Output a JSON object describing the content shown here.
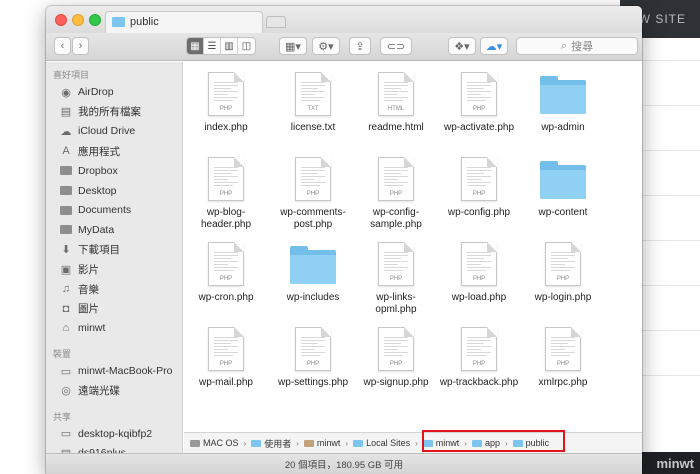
{
  "background_site": {
    "button_fragment": "EW SITE",
    "footer_text": "minwt"
  },
  "window": {
    "tab_title": "public"
  },
  "toolbar": {
    "search_placeholder": "搜尋",
    "view_modes": [
      "icon",
      "list",
      "column",
      "coverflow"
    ],
    "active_view": "icon"
  },
  "sidebar": {
    "sections": [
      {
        "header": "喜好項目",
        "items": [
          {
            "label": "AirDrop",
            "icon": "airdrop-icon"
          },
          {
            "label": "我的所有檔案",
            "icon": "all-files-icon"
          },
          {
            "label": "iCloud Drive",
            "icon": "cloud-icon"
          },
          {
            "label": "應用程式",
            "icon": "applications-icon"
          },
          {
            "label": "Dropbox",
            "icon": "folder-icon"
          },
          {
            "label": "Desktop",
            "icon": "folder-icon"
          },
          {
            "label": "Documents",
            "icon": "folder-icon"
          },
          {
            "label": "MyData",
            "icon": "folder-icon"
          },
          {
            "label": "下載項目",
            "icon": "download-icon"
          },
          {
            "label": "影片",
            "icon": "movie-icon"
          },
          {
            "label": "音樂",
            "icon": "music-icon"
          },
          {
            "label": "圖片",
            "icon": "camera-icon"
          },
          {
            "label": "minwt",
            "icon": "home-icon"
          }
        ]
      },
      {
        "header": "裝置",
        "items": [
          {
            "label": "minwt-MacBook-Pro",
            "icon": "laptop-icon"
          },
          {
            "label": "遠端光碟",
            "icon": "disc-icon"
          }
        ]
      },
      {
        "header": "共享",
        "items": [
          {
            "label": "desktop-kqibfp2",
            "icon": "pc-icon"
          },
          {
            "label": "ds916plus",
            "icon": "server-icon"
          }
        ]
      }
    ]
  },
  "files": [
    {
      "name": "index.php",
      "type": "doc",
      "ext": "PHP"
    },
    {
      "name": "license.txt",
      "type": "doc",
      "ext": "TXT"
    },
    {
      "name": "readme.html",
      "type": "doc",
      "ext": "HTML"
    },
    {
      "name": "wp-activate.php",
      "type": "doc",
      "ext": "PHP"
    },
    {
      "name": "wp-admin",
      "type": "folder",
      "ext": ""
    },
    {
      "name": "wp-blog-header.php",
      "type": "doc",
      "ext": "PHP"
    },
    {
      "name": "wp-comments-post.php",
      "type": "doc",
      "ext": "PHP"
    },
    {
      "name": "wp-config-sample.php",
      "type": "doc",
      "ext": "PHP"
    },
    {
      "name": "wp-config.php",
      "type": "doc",
      "ext": "PHP"
    },
    {
      "name": "wp-content",
      "type": "folder",
      "ext": ""
    },
    {
      "name": "wp-cron.php",
      "type": "doc",
      "ext": "PHP"
    },
    {
      "name": "wp-includes",
      "type": "folder",
      "ext": ""
    },
    {
      "name": "wp-links-opml.php",
      "type": "doc",
      "ext": "PHP"
    },
    {
      "name": "wp-load.php",
      "type": "doc",
      "ext": "PHP"
    },
    {
      "name": "wp-login.php",
      "type": "doc",
      "ext": "PHP"
    },
    {
      "name": "wp-mail.php",
      "type": "doc",
      "ext": "PHP"
    },
    {
      "name": "wp-settings.php",
      "type": "doc",
      "ext": "PHP"
    },
    {
      "name": "wp-signup.php",
      "type": "doc",
      "ext": "PHP"
    },
    {
      "name": "wp-trackback.php",
      "type": "doc",
      "ext": "PHP"
    },
    {
      "name": "xmlrpc.php",
      "type": "doc",
      "ext": "PHP"
    }
  ],
  "pathbar": {
    "items": [
      {
        "label": "MAC OS",
        "icon": "disk-icon"
      },
      {
        "label": "使用者",
        "icon": "folder-icon"
      },
      {
        "label": "minwt",
        "icon": "home-icon"
      },
      {
        "label": "Local Sites",
        "icon": "folder-icon"
      },
      {
        "label": "minwt",
        "icon": "folder-icon"
      },
      {
        "label": "app",
        "icon": "folder-icon"
      },
      {
        "label": "public",
        "icon": "folder-icon"
      }
    ],
    "highlight_color": "#e0141c"
  },
  "status": {
    "text": "20 個項目，180.95 GB 可用"
  },
  "colors": {
    "folder_blue": "#73bfe9",
    "highlight_red": "#e0141c"
  }
}
